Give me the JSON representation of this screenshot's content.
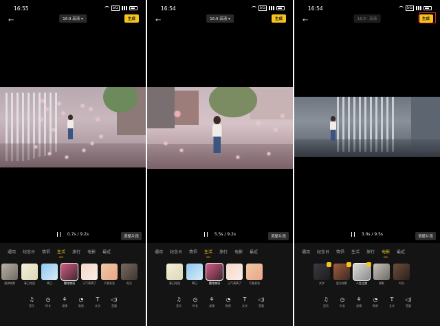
{
  "screens": [
    {
      "status_time": "16:55",
      "ratio_label": "16:9 高清 ▾",
      "generate_label": "生成",
      "playback_time": "0.7s / 9.2s",
      "adjust_label": "调整片段",
      "tabs": [
        "通用",
        "纪念日",
        "情侣",
        "生活",
        "旅行",
        "电影",
        "最近"
      ],
      "active_tab": "生活",
      "templates": [
        "漫游城景",
        "春日花园",
        "晴日",
        "樱花物语",
        "元气满满了",
        "不要紧张",
        "阳光"
      ],
      "selected_template": "樱花物语"
    },
    {
      "status_time": "16:54",
      "ratio_label": "16:9 高清 ▾",
      "generate_label": "生成",
      "playback_time": "5.5s / 9.2s",
      "adjust_label": "调整片段",
      "tabs": [
        "通用",
        "纪念日",
        "情侣",
        "生活",
        "旅行",
        "电影",
        "最近"
      ],
      "active_tab": "生活",
      "templates": [
        "春日花园",
        "晴日",
        "樱花物语",
        "元气满满了",
        "不要紧张"
      ],
      "selected_template": "樱花物语"
    },
    {
      "status_time": "16:54",
      "ratio_label": "16:9 · 高清",
      "generate_label": "生成",
      "playback_time": "3.0s / 9.5s",
      "adjust_label": "调整片段",
      "tabs": [
        "通用",
        "纪念日",
        "情侣",
        "生活",
        "旅行",
        "电影",
        "最近"
      ],
      "active_tab": "电影",
      "templates": [
        "文学",
        "星光电影",
        "人生之旅",
        "暗影",
        "时光"
      ],
      "selected_template": "人生之旅"
    }
  ],
  "tools": [
    "音乐",
    "时长",
    "滤镜",
    "贴纸",
    "文字",
    "音量"
  ],
  "colors": {
    "accent": "#f6c21b",
    "highlight": "#e02a2a",
    "panel": "#141414"
  }
}
